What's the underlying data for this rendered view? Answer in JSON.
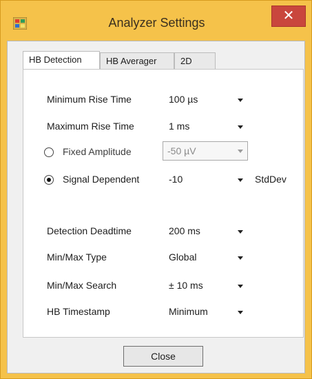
{
  "window": {
    "title": "Analyzer Settings",
    "close_glyph": "✕"
  },
  "tabs": [
    {
      "label": "HB Detection"
    },
    {
      "label": "HB Averager"
    },
    {
      "label": "2D"
    }
  ],
  "settings": {
    "min_rise_time": {
      "label": "Minimum Rise Time",
      "value": "100 µs"
    },
    "max_rise_time": {
      "label": "Maximum Rise Time",
      "value": "1 ms"
    },
    "fixed_amplitude": {
      "label": "Fixed Amplitude",
      "value": "-50 µV",
      "selected": false
    },
    "signal_dependent": {
      "label": "Signal Dependent",
      "value": "-10",
      "unit": "StdDev",
      "selected": true
    },
    "detection_deadtime": {
      "label": "Detection Deadtime",
      "value": "200 ms"
    },
    "minmax_type": {
      "label": "Min/Max Type",
      "value": "Global"
    },
    "minmax_search": {
      "label": "Min/Max Search",
      "value": "± 10 ms"
    },
    "hb_timestamp": {
      "label": "HB Timestamp",
      "value": "Minimum"
    }
  },
  "buttons": {
    "close_label": "Close"
  },
  "colors": {
    "frame": "#f5c24a",
    "close_button": "#c9463d"
  }
}
